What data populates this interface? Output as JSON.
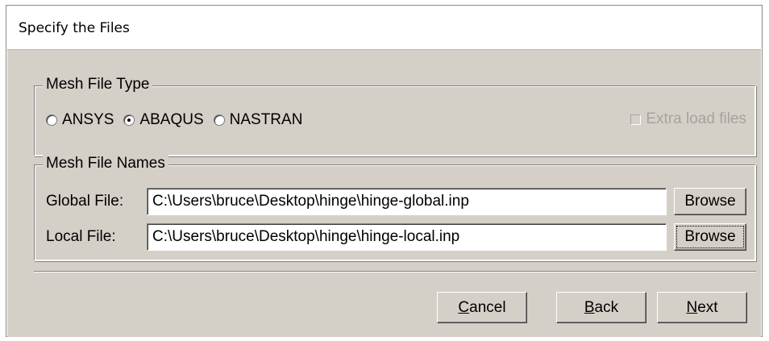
{
  "window": {
    "title": "Specify the Files"
  },
  "mesh_file_type": {
    "label": "Mesh File Type",
    "options": [
      {
        "label": "ANSYS",
        "selected": false
      },
      {
        "label": "ABAQUS",
        "selected": true
      },
      {
        "label": "NASTRAN",
        "selected": false
      }
    ],
    "extra_load_files": {
      "label": "Extra load files",
      "checked": false,
      "enabled": false
    }
  },
  "mesh_file_names": {
    "label": "Mesh File Names",
    "global": {
      "label": "Global File:",
      "value": "C:\\Users\\bruce\\Desktop\\hinge\\hinge-global.inp",
      "browse": "Browse"
    },
    "local": {
      "label": "Local File:",
      "value": "C:\\Users\\bruce\\Desktop\\hinge\\hinge-local.inp",
      "browse": "Browse"
    }
  },
  "buttons": {
    "cancel": {
      "mnemonic": "C",
      "rest": "ancel"
    },
    "back": {
      "mnemonic": "B",
      "rest": "ack"
    },
    "next": {
      "mnemonic": "N",
      "rest": "ext"
    }
  }
}
